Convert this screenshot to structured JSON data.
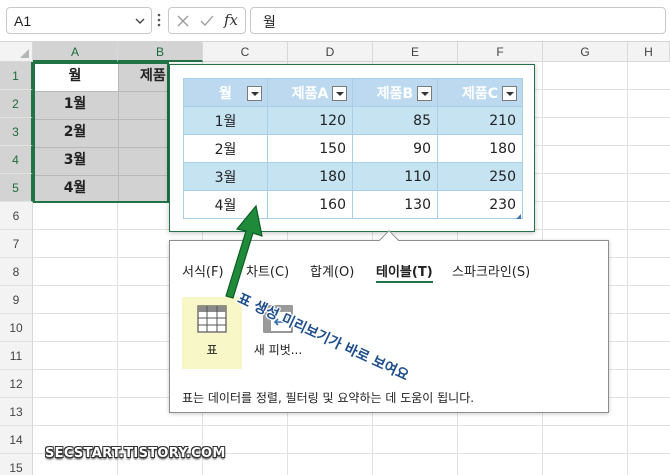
{
  "formula_bar": {
    "name_box": "A1",
    "fx_label": "fx",
    "formula_value": "월"
  },
  "grid": {
    "columns": [
      "A",
      "B",
      "C",
      "D",
      "E",
      "F",
      "G",
      "H"
    ],
    "rows": [
      "1",
      "2",
      "3",
      "4",
      "5",
      "6",
      "7",
      "8",
      "9",
      "10",
      "11",
      "12",
      "13",
      "14",
      "15"
    ],
    "col_a_values": [
      "월",
      "1월",
      "2월",
      "3월",
      "4월"
    ],
    "b1_value": "제품"
  },
  "preview_table": {
    "headers": [
      "월",
      "제품A",
      "제품B",
      "제품C"
    ],
    "rows": [
      [
        "1월",
        "120",
        "85",
        "210"
      ],
      [
        "2월",
        "150",
        "90",
        "180"
      ],
      [
        "3월",
        "180",
        "110",
        "250"
      ],
      [
        "4월",
        "160",
        "130",
        "230"
      ]
    ]
  },
  "quick_analysis": {
    "tabs": [
      "서식(F)",
      "차트(C)",
      "합계(O)",
      "테이블(T)",
      "스파크라인(S)"
    ],
    "active_tab": "테이블(T)",
    "options": [
      "표",
      "새 피벗..."
    ],
    "hint": "표는 데이터를 정렬, 필터링 및 요약하는 데 도움이 됩니다."
  },
  "annotation": "표 생성 미리보기가 바로 보여요",
  "watermark": "SECSTART.TISTORY.COM",
  "colors": {
    "accent": "#217346",
    "table_header": "#bcd9ef",
    "table_band": "#c6e3f2",
    "arrow": "#1f8a3a",
    "annotation_text": "#1e4e8c"
  }
}
